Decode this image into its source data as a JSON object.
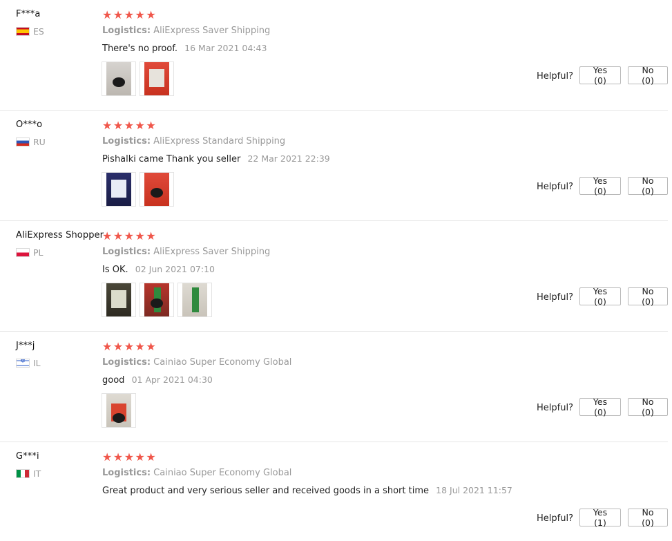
{
  "ui": {
    "helpful_label": "Helpful?",
    "logistics_label": "Logistics:",
    "star_color": "#f0564a",
    "stars": "★★★★★"
  },
  "reviews": [
    {
      "user": "F***a",
      "country": "ES",
      "flag": "spain-flag",
      "rating": 5,
      "logistics": "AliExpress Saver Shipping",
      "comment": "There's no proof.",
      "date": "16 Mar 2021 04:43",
      "photos": 2,
      "yes": "Yes (0)",
      "no": "No (0)"
    },
    {
      "user": "O***o",
      "country": "RU",
      "flag": "russia-flag",
      "rating": 5,
      "logistics": "AliExpress Standard Shipping",
      "comment": "Pishalki came Thank you seller",
      "date": "22 Mar 2021 22:39",
      "photos": 2,
      "yes": "Yes (0)",
      "no": "No (0)"
    },
    {
      "user": "AliExpress Shopper",
      "country": "PL",
      "flag": "poland-flag",
      "rating": 5,
      "logistics": "AliExpress Saver Shipping",
      "comment": "Is OK.",
      "date": "02 Jun 2021 07:10",
      "photos": 3,
      "yes": "Yes (0)",
      "no": "No (0)"
    },
    {
      "user": "J***j",
      "country": "IL",
      "flag": "israel-flag",
      "rating": 5,
      "logistics": "Cainiao Super Economy Global",
      "comment": "good",
      "date": "01 Apr 2021 04:30",
      "photos": 1,
      "yes": "Yes (0)",
      "no": "No (0)"
    },
    {
      "user": "G***i",
      "country": "IT",
      "flag": "italy-flag",
      "rating": 5,
      "logistics": "Cainiao Super Economy Global",
      "comment": "Great product and very serious seller and received goods in a short time",
      "date": "18 Jul 2021 11:57",
      "photos": 0,
      "yes": "Yes (1)",
      "no": "No (0)"
    }
  ]
}
